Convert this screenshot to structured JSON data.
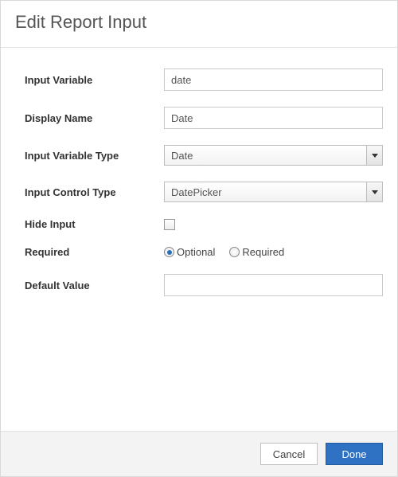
{
  "header": {
    "title": "Edit Report Input"
  },
  "labels": {
    "inputVariable": "Input Variable",
    "displayName": "Display Name",
    "inputVariableType": "Input Variable Type",
    "inputControlType": "Input Control Type",
    "hideInput": "Hide Input",
    "required": "Required",
    "defaultValue": "Default Value"
  },
  "fields": {
    "inputVariable": "date",
    "displayName": "Date",
    "inputVariableType": "Date",
    "inputControlType": "DatePicker",
    "hideInput": false,
    "requiredSelected": "optional",
    "defaultValue": ""
  },
  "radios": {
    "optional": "Optional",
    "required": "Required"
  },
  "buttons": {
    "cancel": "Cancel",
    "done": "Done"
  }
}
